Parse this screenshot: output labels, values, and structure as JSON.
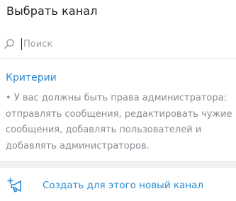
{
  "dialog": {
    "title": "Выбрать канал"
  },
  "search": {
    "placeholder": "Поиск",
    "value": ""
  },
  "criteria": {
    "title": "Критерии",
    "text": "• У вас должны быть права администратора:\nотправлять сообщения, редактировать чужие\nсообщения, добавлять пользователей и\nдобавлять администраторов."
  },
  "create_channel": {
    "label": "Создать для этого новый канал"
  },
  "icons": {
    "search": "search-icon",
    "create": "megaphone-plus-icon"
  },
  "colors": {
    "accent": "#2b8bd1",
    "muted_text": "#878c91",
    "title_text": "#222222"
  }
}
